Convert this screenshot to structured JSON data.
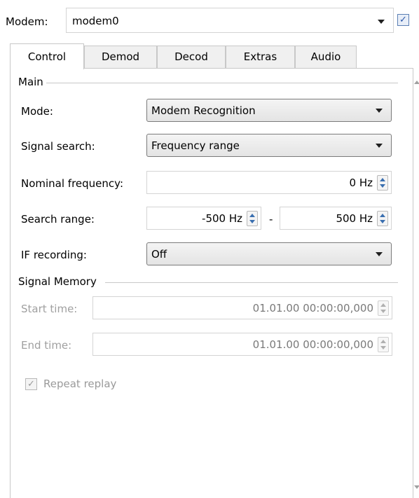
{
  "modem_row": {
    "label": "Modem:",
    "selected": "modem0",
    "enabled_checked": true
  },
  "tabs": [
    {
      "label": "Control",
      "active": true
    },
    {
      "label": "Demod",
      "active": false
    },
    {
      "label": "Decod",
      "active": false
    },
    {
      "label": "Extras",
      "active": false
    },
    {
      "label": "Audio",
      "active": false
    }
  ],
  "main_group": {
    "title": "Main",
    "mode": {
      "label": "Mode:",
      "value": "Modem Recognition"
    },
    "signal_search": {
      "label": "Signal search:",
      "value": "Frequency range"
    },
    "nominal_frequency": {
      "label": "Nominal frequency:",
      "value": "0 Hz"
    },
    "search_range": {
      "label": "Search range:",
      "from": "-500 Hz",
      "separator": "-",
      "to": "500 Hz"
    },
    "if_recording": {
      "label": "IF recording:",
      "value": "Off"
    }
  },
  "signal_memory_group": {
    "title": "Signal Memory",
    "start_time": {
      "label": "Start time:",
      "value": "01.01.00 00:00:00,000"
    },
    "end_time": {
      "label": "End time:",
      "value": "01.01.00 00:00:00,000"
    },
    "repeat_replay": {
      "label": "Repeat replay",
      "checked": true,
      "enabled": false
    }
  },
  "icons": {
    "dropdown": "chevron-down-icon",
    "check": "check-icon",
    "spin_up": "arrow-up-icon",
    "spin_down": "arrow-down-icon"
  },
  "colors": {
    "border": "#c8c8c8",
    "spin_arrow": "#3a6fb0",
    "disabled_text": "#a0a0a0"
  }
}
